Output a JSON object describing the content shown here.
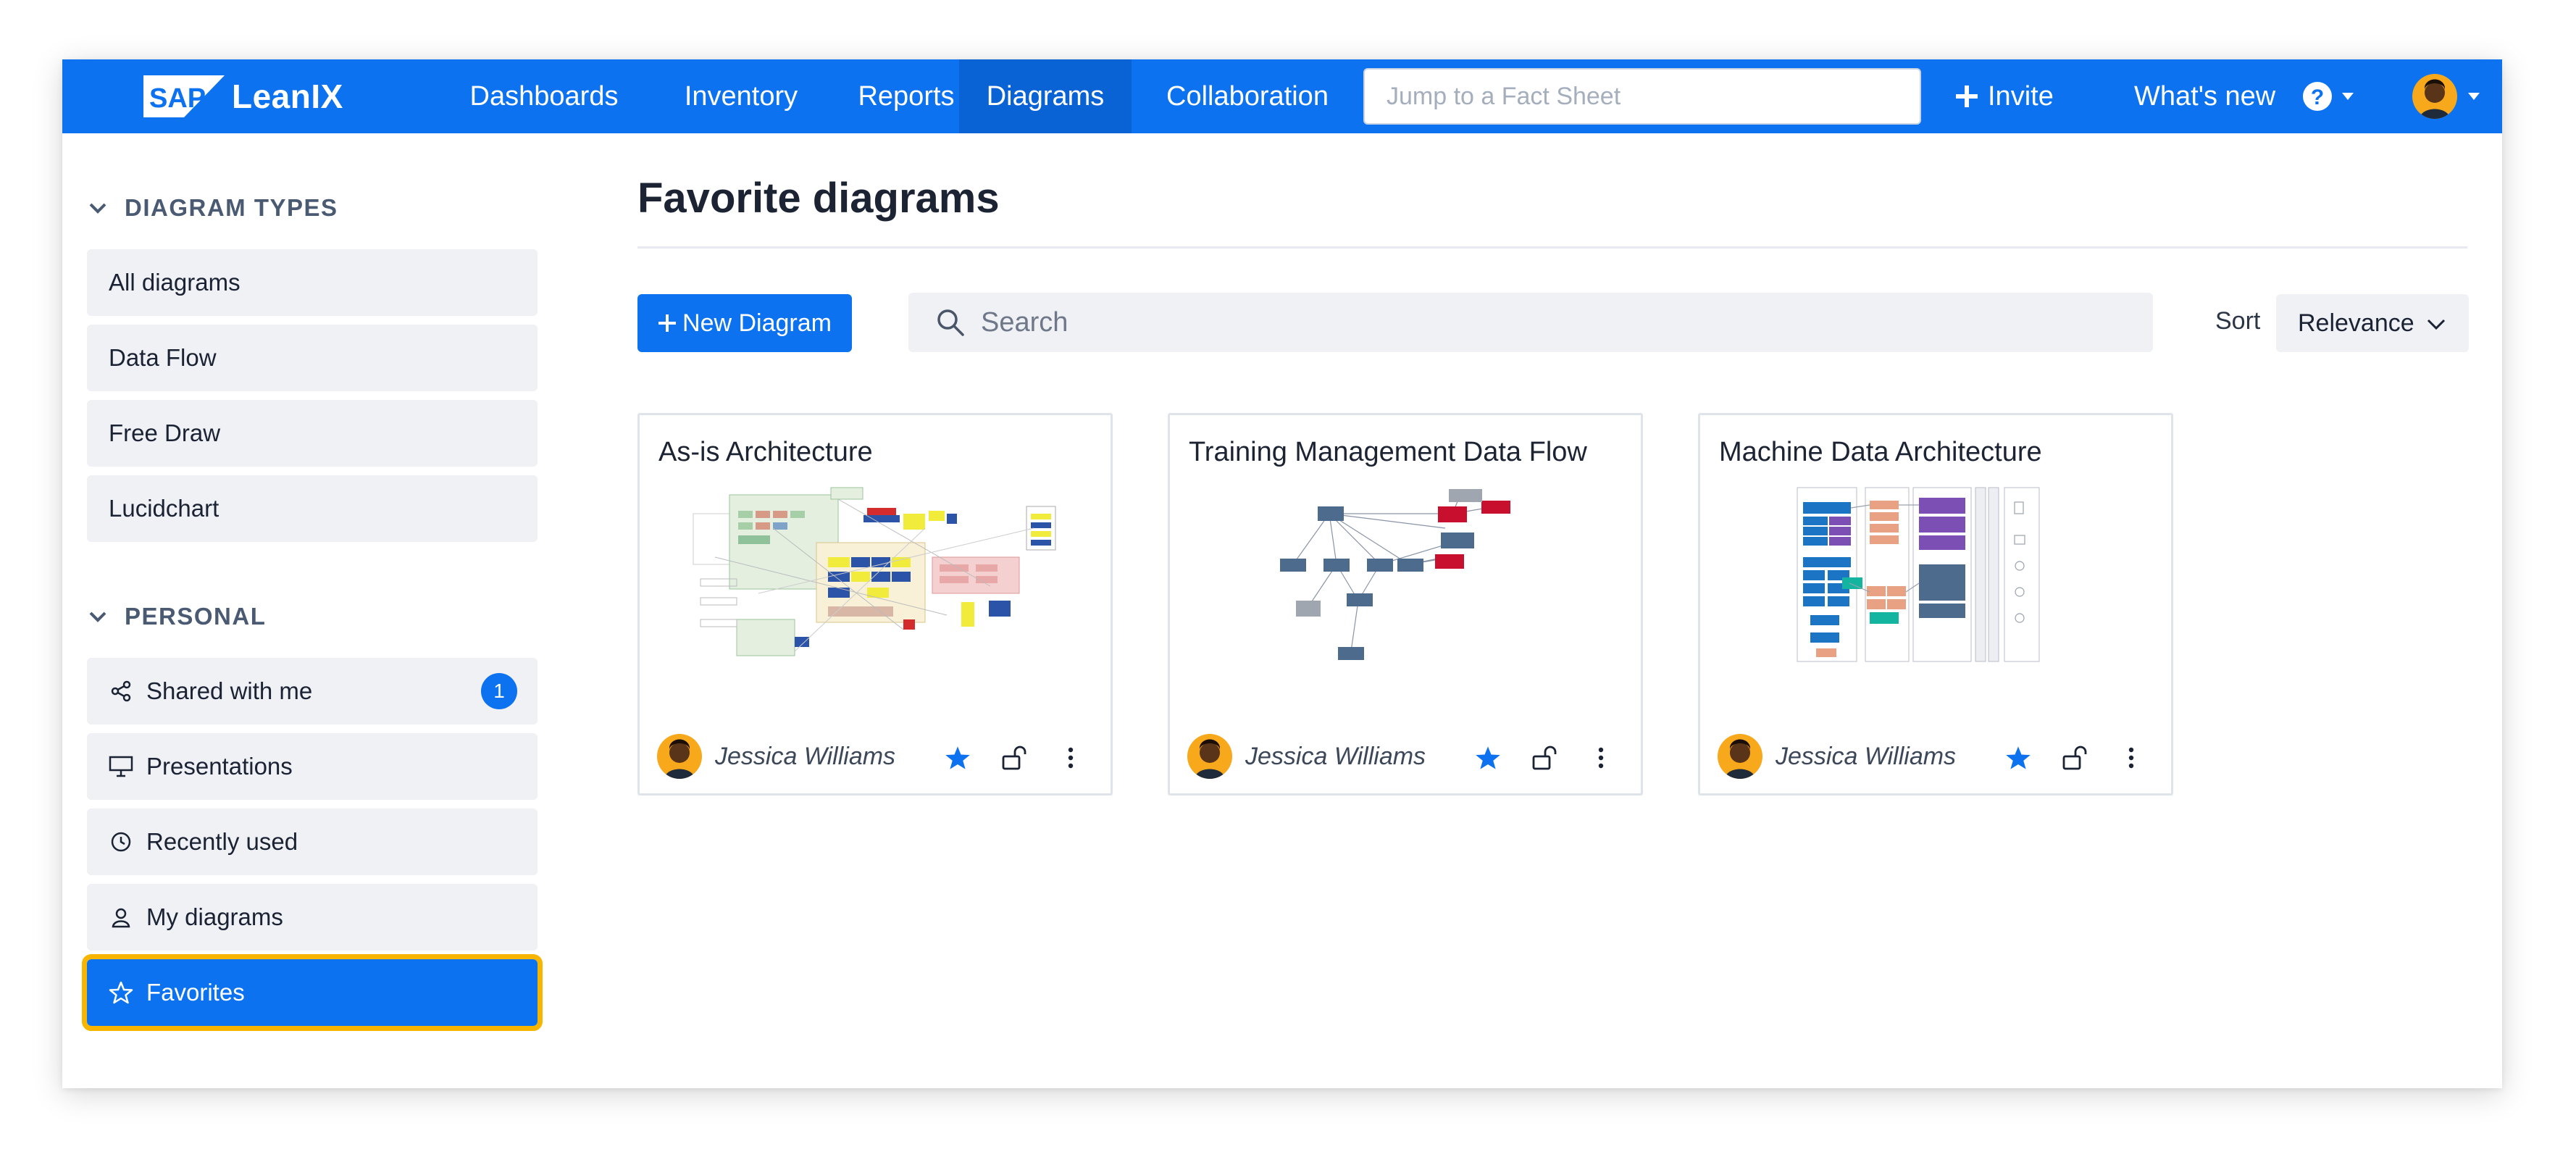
{
  "brand": {
    "sap": "SAP",
    "name": "LeanIX"
  },
  "nav": {
    "items": [
      {
        "label": "Dashboards"
      },
      {
        "label": "Inventory"
      },
      {
        "label": "Reports"
      },
      {
        "label": "Diagrams"
      },
      {
        "label": "Collaboration"
      }
    ],
    "active": "Diagrams",
    "jump_placeholder": "Jump to a Fact Sheet",
    "invite_label": "Invite",
    "whats_new_label": "What's new"
  },
  "sidebar": {
    "diagram_types": {
      "header": "DIAGRAM TYPES",
      "items": [
        {
          "label": "All diagrams"
        },
        {
          "label": "Data Flow"
        },
        {
          "label": "Free Draw"
        },
        {
          "label": "Lucidchart"
        }
      ]
    },
    "personal": {
      "header": "PERSONAL",
      "items": [
        {
          "label": "Shared with me",
          "icon": "share-icon",
          "badge": "1"
        },
        {
          "label": "Presentations",
          "icon": "presentation-icon"
        },
        {
          "label": "Recently used",
          "icon": "clock-icon"
        },
        {
          "label": "My diagrams",
          "icon": "user-icon"
        },
        {
          "label": "Favorites",
          "icon": "star-icon",
          "selected": true
        }
      ]
    }
  },
  "main": {
    "title": "Favorite diagrams",
    "new_button": "New Diagram",
    "search_placeholder": "Search",
    "sort_label": "Sort",
    "sort_value": "Relevance",
    "cards": [
      {
        "title": "As-is Architecture",
        "owner": "Jessica Williams",
        "favorite": true
      },
      {
        "title": "Training Management Data Flow",
        "owner": "Jessica Williams",
        "favorite": true
      },
      {
        "title": "Machine Data Architecture",
        "owner": "Jessica Williams",
        "favorite": true
      }
    ]
  },
  "colors": {
    "primary": "#0c72f0",
    "highlight": "#f7b500",
    "sidebar_bg": "#eff1f5",
    "avatar": "#f7a81b"
  }
}
